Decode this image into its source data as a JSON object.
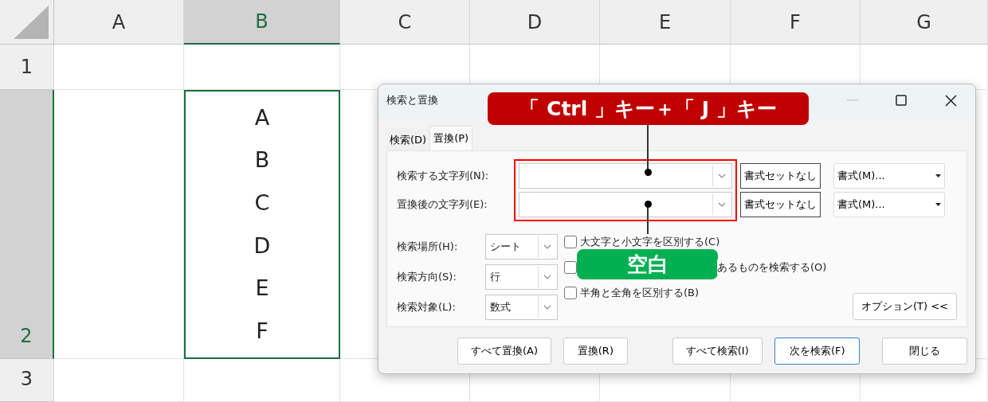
{
  "sheet": {
    "columns": [
      {
        "label": "A",
        "selected": false
      },
      {
        "label": "B",
        "selected": true
      },
      {
        "label": "C",
        "selected": false
      },
      {
        "label": "D",
        "selected": false
      },
      {
        "label": "E",
        "selected": false
      },
      {
        "label": "F",
        "selected": false
      },
      {
        "label": "G",
        "selected": false
      }
    ],
    "rows": [
      {
        "label": "1",
        "selected": false
      },
      {
        "label": "2",
        "selected": true
      },
      {
        "label": "3",
        "selected": false
      }
    ],
    "active_cell": {
      "lines": [
        "A",
        "B",
        "C",
        "D",
        "E",
        "F"
      ]
    }
  },
  "dialog": {
    "title": "検索と置換",
    "tabs": [
      {
        "label": "検索(D)",
        "selected": false
      },
      {
        "label": "置換(P)",
        "selected": true
      }
    ],
    "fields": [
      {
        "label": "検索する文字列(N):",
        "format_status": "書式セットなし",
        "format_button": "書式(M)..."
      },
      {
        "label": "置換後の文字列(E):",
        "format_status": "書式セットなし",
        "format_button": "書式(M)..."
      }
    ],
    "options": [
      {
        "label": "検索場所(H):",
        "value": "シート"
      },
      {
        "label": "検索方向(S):",
        "value": "行"
      },
      {
        "label": "検索対象(L):",
        "value": "数式"
      }
    ],
    "checkboxes": [
      {
        "label": "大文字と小文字を区別する(C)",
        "checked": false
      },
      {
        "label": "あるものを検索する(O)",
        "checked": false
      },
      {
        "label": "半角と全角を区別する(B)",
        "checked": false
      }
    ],
    "options_button": "オプション(T) <<",
    "buttons": [
      {
        "label": "すべて置換(A)",
        "default": false
      },
      {
        "label": "置換(R)",
        "default": false
      },
      {
        "label": "すべて検索(I)",
        "default": false
      },
      {
        "label": "次を検索(F)",
        "default": true
      },
      {
        "label": "閉じる",
        "default": false
      }
    ]
  },
  "callouts": [
    {
      "kind": "key",
      "text": "「 Ctrl 」キー＋「 J 」キー"
    },
    {
      "kind": "value",
      "text": "空白"
    }
  ]
}
